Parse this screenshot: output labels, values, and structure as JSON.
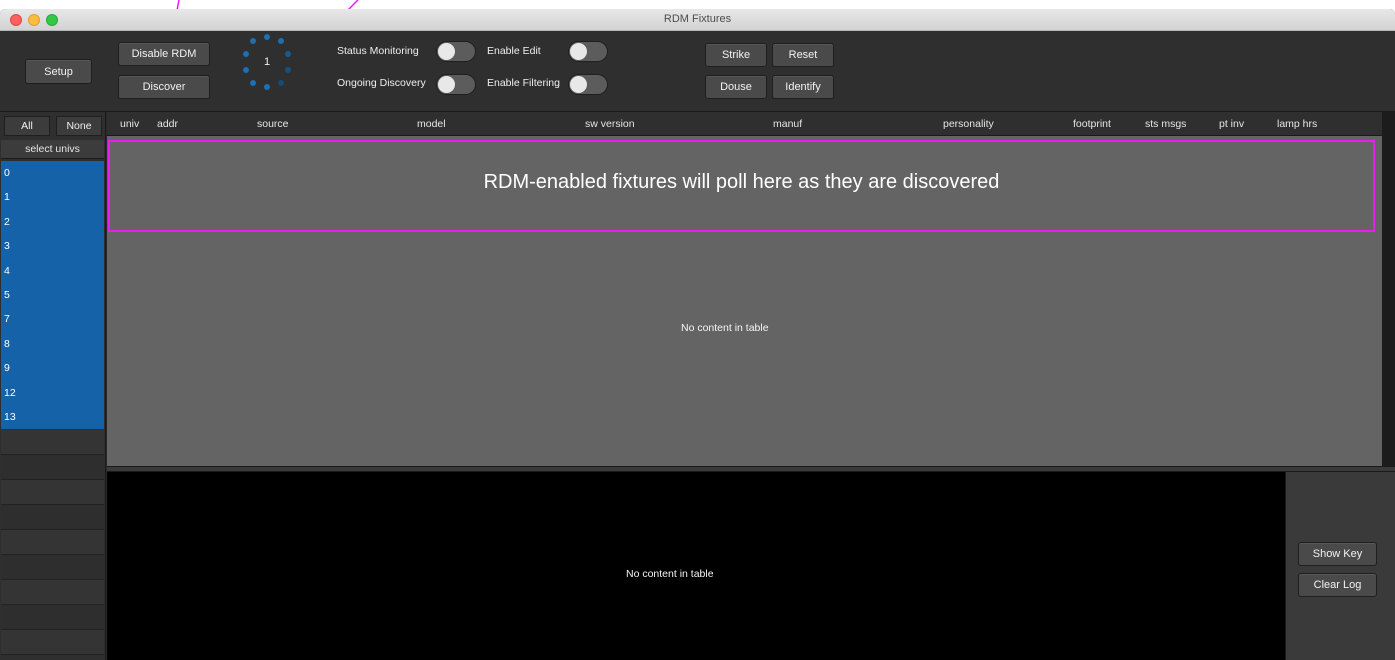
{
  "window": {
    "title": "RDM Fixtures"
  },
  "toolbar": {
    "setup_label": "Setup",
    "disable_rdm_label": "Disable RDM",
    "discover_label": "Discover",
    "spinner_count": "1",
    "status_monitoring_label": "Status Monitoring",
    "ongoing_discovery_label": "Ongoing Discovery",
    "enable_edit_label": "Enable Edit",
    "enable_filtering_label": "Enable Filtering",
    "strike_label": "Strike",
    "reset_label": "Reset",
    "douse_label": "Douse",
    "identify_label": "Identify"
  },
  "sidebar": {
    "all_label": "All",
    "none_label": "None",
    "header": "select univs",
    "universes": [
      "0",
      "1",
      "2",
      "3",
      "4",
      "5",
      "7",
      "8",
      "9",
      "12",
      "13"
    ]
  },
  "table": {
    "columns": [
      "univ",
      "addr",
      "source",
      "model",
      "sw version",
      "manuf",
      "personality",
      "footprint",
      "sts msgs",
      "pt inv",
      "lamp hrs"
    ],
    "empty_message": "No content in table"
  },
  "annotation": {
    "text": "RDM-enabled fixtures will poll here as they are discovered"
  },
  "log": {
    "empty_message": "No content in table",
    "show_key_label": "Show Key",
    "clear_log_label": "Clear Log"
  },
  "colors": {
    "accent_blue": "#1662a8",
    "annotation_magenta": "#e81ef0",
    "window_bg": "#2a2a2a",
    "table_bg": "#646464"
  }
}
